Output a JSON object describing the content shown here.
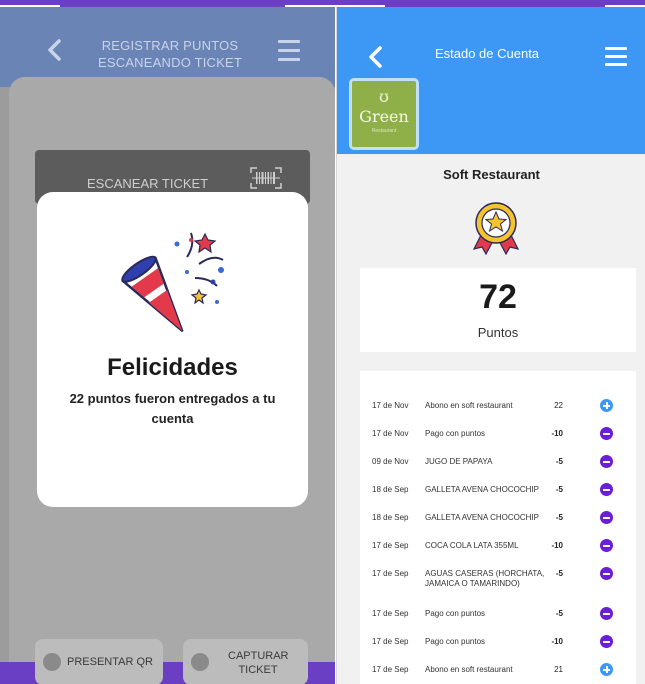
{
  "left_screen": {
    "header": {
      "title_line1": "REGISTRAR PUNTOS",
      "title_line2": "ESCANEANDO TICKET"
    },
    "scan_button": {
      "label": "ESCANEAR TICKET"
    },
    "modal": {
      "title": "Felicidades",
      "message": "22 puntos fueron entregados a tu cuenta"
    },
    "footer": {
      "qr_label": "PRESENTAR QR",
      "capture_line1": "CAPTURAR",
      "capture_line2": "TICKET"
    }
  },
  "right_screen": {
    "header": {
      "title": "Estado de Cuenta"
    },
    "logo": {
      "mark": "ʊ",
      "text": "Green",
      "sub": "Restaurant"
    },
    "restaurant_name": "Soft Restaurant",
    "points": {
      "value": "72",
      "label": "Puntos"
    },
    "transactions": [
      {
        "date": "17 de Nov",
        "desc": "Abono en soft restaurant",
        "points": "22",
        "type": "plus"
      },
      {
        "date": "17 de Nov",
        "desc": "Pago con puntos",
        "points": "-10",
        "type": "minus"
      },
      {
        "date": "09 de Nov",
        "desc": "JUGO DE PAPAYA",
        "points": "-5",
        "type": "minus"
      },
      {
        "date": "18 de Sep",
        "desc": "GALLETA AVENA CHOCOCHIP",
        "points": "-5",
        "type": "minus"
      },
      {
        "date": "18 de Sep",
        "desc": "GALLETA AVENA CHOCOCHIP",
        "points": "-5",
        "type": "minus"
      },
      {
        "date": "17 de Sep",
        "desc": "COCA COLA LATA 355ML",
        "points": "-10",
        "type": "minus"
      },
      {
        "date": "17 de Sep",
        "desc": "AGUAS CASERAS (HORCHATA, JAMAICA O TAMARINDO)",
        "points": "-5",
        "type": "minus"
      },
      {
        "date": "17 de Sep",
        "desc": "Pago con puntos",
        "points": "-5",
        "type": "minus"
      },
      {
        "date": "17 de Sep",
        "desc": "Pago con puntos",
        "points": "-10",
        "type": "minus"
      },
      {
        "date": "17 de Sep",
        "desc": "Abono en soft restaurant",
        "points": "21",
        "type": "plus"
      }
    ]
  },
  "colors": {
    "purple": "#6a3fc4",
    "blue_header": "#3c97f5",
    "minus_icon": "#6a1fd6",
    "plus_icon": "#3c97f5"
  }
}
